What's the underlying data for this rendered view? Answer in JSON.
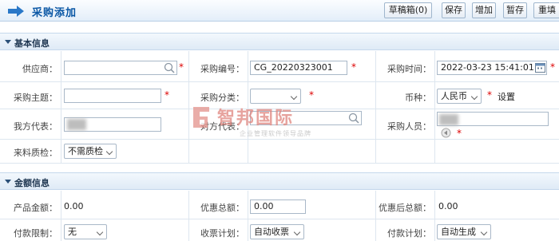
{
  "header": {
    "title": "采购添加",
    "buttons": [
      "草稿箱(0)",
      "保存",
      "增加",
      "暂存",
      "重填"
    ]
  },
  "sections": {
    "basic": "基本信息",
    "amount": "金额信息"
  },
  "basic": {
    "supplier_label": "供应商：",
    "supplier_value": "",
    "purchase_no_label": "采购编号：",
    "purchase_no_value": "CG_20220323001",
    "purchase_time_label": "采购时间：",
    "purchase_time_value": "2022-03-23 15:41:01",
    "subject_label": "采购主题：",
    "subject_value": "",
    "category_label": "采购分类：",
    "category_value": "",
    "currency_label": "币种：",
    "currency_value": "人民币",
    "settings_link": "设置",
    "our_rep_label": "我方代表：",
    "other_rep_label": "对方代表：",
    "purchaser_label": "采购人员：",
    "qc_label": "来料质检：",
    "qc_value": "不需质检"
  },
  "amount": {
    "product_amount_label": "产品金额：",
    "product_amount_value": "0.00",
    "discount_total_label": "优惠总额：",
    "discount_total_value": "0.00",
    "after_discount_label": "优惠后总额：",
    "after_discount_value": "0.00",
    "payment_limit_label": "付款限制：",
    "payment_limit_value": "无",
    "receipt_plan_label": "收票计划：",
    "receipt_plan_value": "自动收票",
    "payment_plan_label": "付款计划：",
    "payment_plan_value": "自动生成"
  },
  "watermark": {
    "name": "智邦国际",
    "tagline": "企业管理软件领导品牌"
  },
  "colors": {
    "title": "#0a57a5",
    "required": "#dd0000",
    "watermark": "#e0857e"
  }
}
